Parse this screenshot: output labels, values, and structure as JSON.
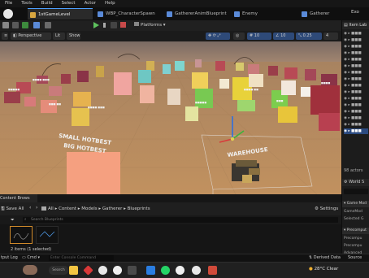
{
  "menu": [
    "File",
    "Tools",
    "Build",
    "Select",
    "Actor",
    "Help"
  ],
  "tabs": [
    {
      "label": "1stGameLevel",
      "active": true
    },
    {
      "label": "WBP_CharacterSpawn",
      "active": false
    },
    {
      "label": "GathererAnimBlueprint",
      "active": false
    },
    {
      "label": "Enemy",
      "active": false
    },
    {
      "label": "Gatherer",
      "active": false
    }
  ],
  "window_title": "Exo",
  "toolbar": {
    "platforms_label": "Platforms"
  },
  "viewport_bar": {
    "perspective": "Perspective",
    "lit": "Lit",
    "show": "Show",
    "grid_snap": "10",
    "rot_snap": "10",
    "scale_snap": "0.25",
    "cam_speed": "4"
  },
  "scene": {
    "labels": [
      "SMALL HOTBEST",
      "BIG HOTBEST",
      "WAREHOUSE"
    ]
  },
  "outliner": {
    "header": "Item Lab",
    "actors_count": "98 actors",
    "world_settings": "World S",
    "game_mode_header": "Game Mod",
    "game_mode_rows": [
      "GameMod",
      "Selected G"
    ],
    "precompute_header": "Precomput",
    "precompute_rows": [
      "Precompu",
      "Precompu",
      "Advanced"
    ]
  },
  "content_browser": {
    "tab_label": "Content Brows",
    "save_all": "Save All",
    "path": [
      "All",
      "Content",
      "Models",
      "Gatherer",
      "Blueprints"
    ],
    "settings": "Settings",
    "search_placeholder": "Search Blueprints",
    "status": "2 items (1 selected)"
  },
  "bottom_bar": {
    "output_log": "tput Log",
    "cmd": "Cmd",
    "console_placeholder": "Enter Console Command",
    "derived_data": "Derived Data",
    "source_control": "Source"
  },
  "taskbar": {
    "search_label": "Search",
    "weather": "28°C Clear"
  },
  "colors": {
    "accent": "#4d9fff",
    "floor": "#b8895c",
    "sky": "#8d7463"
  }
}
